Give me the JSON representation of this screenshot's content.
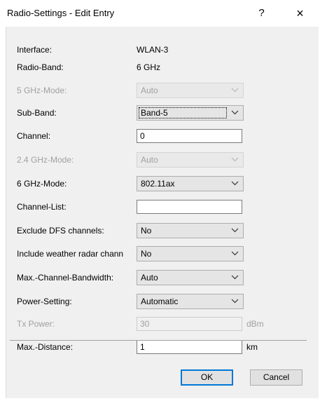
{
  "window": {
    "title": "Radio-Settings - Edit Entry",
    "help_label": "?",
    "close_label": "×"
  },
  "fields": {
    "interface": {
      "label": "Interface:",
      "value": "WLAN-3"
    },
    "radio_band": {
      "label": "Radio-Band:",
      "value": "6 GHz"
    },
    "mode_5ghz": {
      "label": "5 GHz-Mode:",
      "value": "Auto"
    },
    "sub_band": {
      "label": "Sub-Band:",
      "value": "Band-5"
    },
    "channel": {
      "label": "Channel:",
      "value": "0"
    },
    "mode_24ghz": {
      "label": "2.4 GHz-Mode:",
      "value": "Auto"
    },
    "mode_6ghz": {
      "label": "6 GHz-Mode:",
      "value": "802.11ax"
    },
    "channel_list": {
      "label": "Channel-List:",
      "value": ""
    },
    "exclude_dfs": {
      "label": "Exclude DFS channels:",
      "value": "No"
    },
    "weather_radar": {
      "label": "Include weather radar chann",
      "value": "No"
    },
    "max_bandwidth": {
      "label": "Max.-Channel-Bandwidth:",
      "value": "Auto"
    },
    "power_setting": {
      "label": "Power-Setting:",
      "value": "Automatic"
    },
    "tx_power": {
      "label": "Tx Power:",
      "value": "30",
      "unit": "dBm"
    },
    "max_distance": {
      "label": "Max.-Distance:",
      "value": "1",
      "unit": "km"
    }
  },
  "buttons": {
    "ok": "OK",
    "cancel": "Cancel"
  },
  "icons": {
    "dropdown": "chevron-down-icon",
    "help": "help-icon",
    "close": "close-icon"
  }
}
